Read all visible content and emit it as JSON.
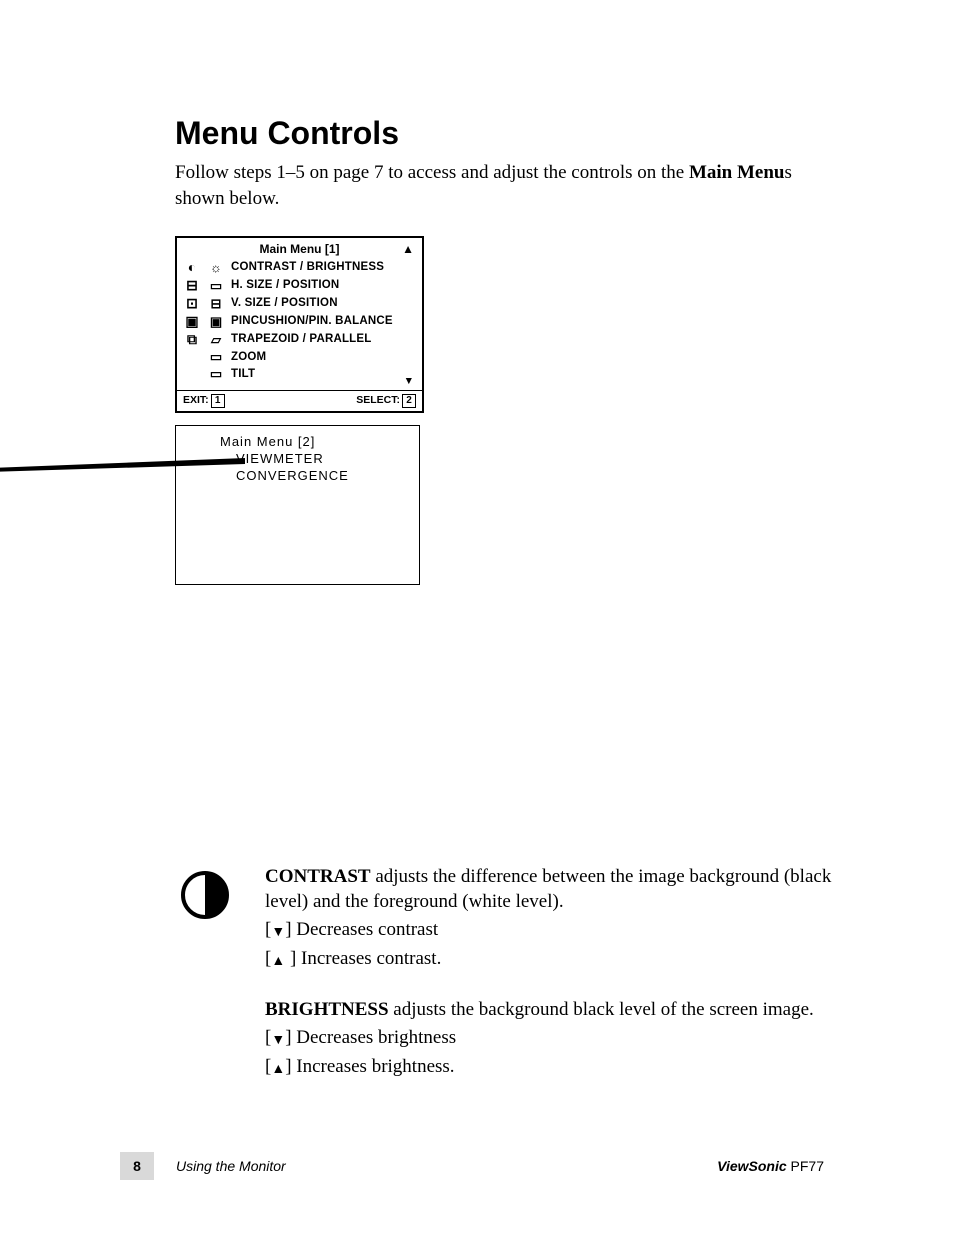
{
  "heading": "Menu Controls",
  "intro_pre": "Follow steps 1–5 on page 7 to access and adjust the controls on the ",
  "intro_bold": "Main Menu",
  "intro_post": "s  shown below.",
  "menu1": {
    "title": "Main Menu [1]",
    "items": [
      "CONTRAST / BRIGHTNESS",
      "H. SIZE / POSITION",
      "V. SIZE / POSITION",
      "PINCUSHION/PIN. BALANCE",
      "TRAPEZOID / PARALLEL",
      "ZOOM",
      "TILT"
    ],
    "exit_label": "EXIT:",
    "exit_key": "1",
    "select_label": "SELECT:",
    "select_key": "2"
  },
  "menu2": {
    "title": "Main Menu  [2]",
    "items": [
      "VIEWMETER",
      "CONVERGENCE"
    ]
  },
  "contrast": {
    "term": "CONTRAST",
    "body": " adjusts the difference between the image background (black level) and the foreground (white level).",
    "dec": "] Decreases contrast",
    "inc": " ] Increases contrast."
  },
  "brightness": {
    "term": "BRIGHTNESS",
    "body": " adjusts the background black level of the screen image.",
    "dec": "] Decreases brightness",
    "inc": "] Increases brightness."
  },
  "footer": {
    "page": "8",
    "section": "Using the Monitor",
    "brand": "ViewSonic",
    "model": " PF77"
  }
}
